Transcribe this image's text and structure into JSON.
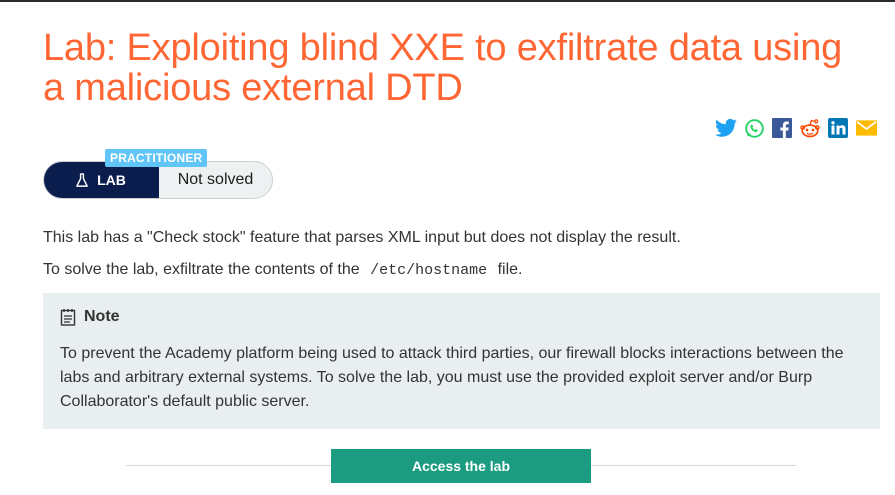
{
  "title": "Lab: Exploiting blind XXE to exfiltrate data using a malicious external DTD",
  "share": [
    {
      "name": "twitter-icon",
      "color": "#1da1f2"
    },
    {
      "name": "whatsapp-icon",
      "color": "#25d366"
    },
    {
      "name": "facebook-icon",
      "color": "#3b5998"
    },
    {
      "name": "reddit-icon",
      "color": "#ff4500"
    },
    {
      "name": "linkedin-icon",
      "color": "#0077b5"
    },
    {
      "name": "email-icon",
      "color": "#ffbb00"
    }
  ],
  "badge": {
    "level": "PRACTITIONER",
    "lab_label": "LAB",
    "status": "Not solved"
  },
  "description": {
    "line1": "This lab has a \"Check stock\" feature that parses XML input but does not display the result.",
    "line2_before": "To solve the lab, exfiltrate the contents of the",
    "line2_code": "/etc/hostname",
    "line2_after": "file."
  },
  "note": {
    "heading": "Note",
    "body": "To prevent the Academy platform being used to attack third parties, our firewall blocks interactions between the labs and arbitrary external systems. To solve the lab, you must use the provided exploit server and/or Burp Collaborator's default public server."
  },
  "access_button": "Access the lab",
  "colors": {
    "title": "#ff6633",
    "lab_badge": "#0a1d4c",
    "level_badge": "#61c5f7",
    "access_button": "#1b9b80",
    "note_bg": "#e9eef0"
  }
}
